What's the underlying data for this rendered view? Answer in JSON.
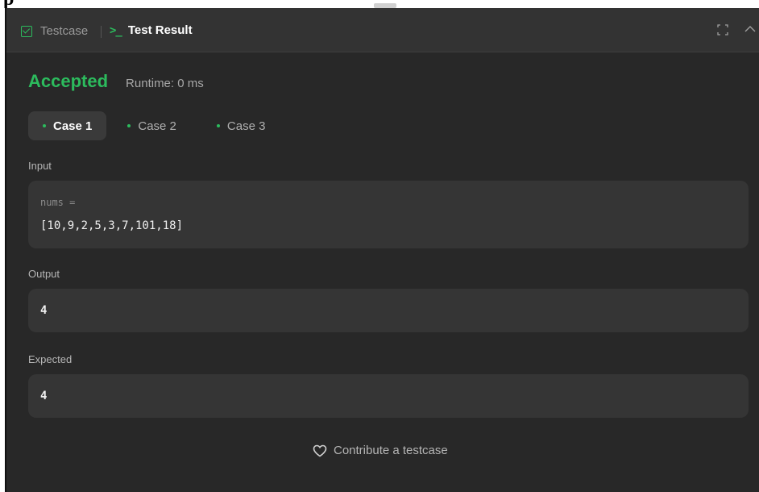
{
  "page": {
    "fragment_glyph": "p"
  },
  "header": {
    "tabs": [
      {
        "label": "Testcase",
        "icon": "checkbox-icon",
        "active": false
      },
      {
        "label": "Test Result",
        "icon": "terminal-prompt-icon",
        "active": true
      }
    ],
    "prompt_glyph": ">_",
    "actions": [
      "expand-icon",
      "chevron-up-icon"
    ]
  },
  "result": {
    "status": "Accepted",
    "runtime": "Runtime: 0 ms",
    "status_color": "#2cbb5d"
  },
  "cases": [
    {
      "label": "Case 1",
      "active": true
    },
    {
      "label": "Case 2",
      "active": false
    },
    {
      "label": "Case 3",
      "active": false
    }
  ],
  "input": {
    "label": "Input",
    "var_name": "nums =",
    "value": "[10,9,2,5,3,7,101,18]"
  },
  "output": {
    "label": "Output",
    "value": "4"
  },
  "expected": {
    "label": "Expected",
    "value": "4"
  },
  "footer": {
    "contribute_label": "Contribute a testcase",
    "icon": "heart-icon"
  },
  "colors": {
    "accent_green": "#2cbb5d",
    "panel_bg": "#282828",
    "header_bg": "#333333",
    "box_bg": "#353535"
  }
}
